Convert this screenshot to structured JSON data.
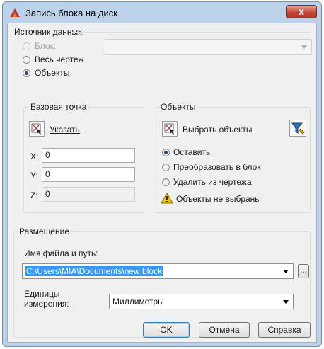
{
  "window": {
    "title": "Запись блока на диск",
    "close_glyph": "x"
  },
  "source": {
    "title": "Источник данных",
    "block_label": "Блок:",
    "block_value": "",
    "whole_drawing_label": "Весь чертеж",
    "objects_label": "Объекты",
    "selected": "objects"
  },
  "base_point": {
    "title": "Базовая точка",
    "pick_label": "Указать",
    "x_label": "X:",
    "x_value": "0",
    "y_label": "Y:",
    "y_value": "0",
    "z_label": "Z:",
    "z_value": "0"
  },
  "objects": {
    "title": "Объекты",
    "select_label": "Выбрать объекты",
    "keep_label": "Оставить",
    "convert_label": "Преобразовать в блок",
    "delete_label": "Удалить из чертежа",
    "selected": "keep",
    "warning_text": "Объекты не выбраны"
  },
  "destination": {
    "title": "Размещение",
    "file_label": "Имя файла и путь:",
    "file_value": "C:\\Users\\MIA\\Documents\\new block",
    "browse_label": "...",
    "units_label_1": "Единицы",
    "units_label_2": "измерения:",
    "units_value": "Миллиметры"
  },
  "buttons": {
    "ok": "OK",
    "cancel": "Отмена",
    "help": "Справка"
  },
  "colors": {
    "accent": "#3399ff",
    "frame": "#bcd2ea",
    "warning": "#f2c500"
  }
}
